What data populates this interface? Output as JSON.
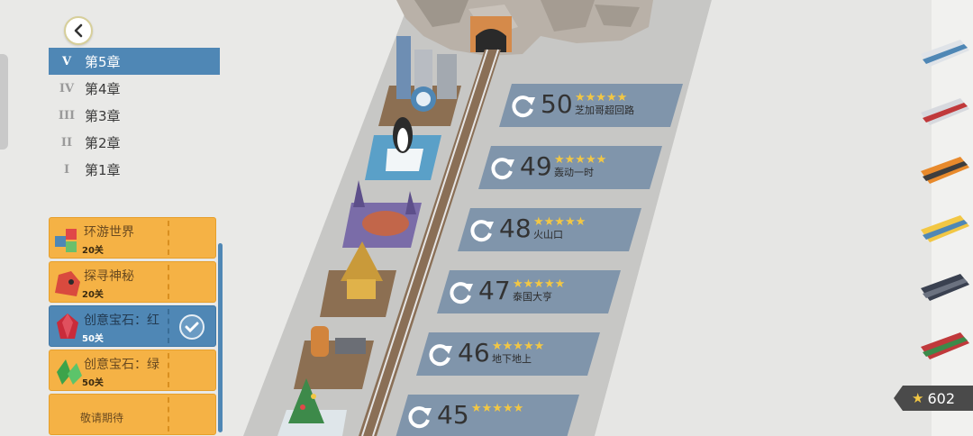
{
  "chapters": [
    {
      "numeral": "V",
      "label": "第5章",
      "active": true
    },
    {
      "numeral": "IV",
      "label": "第4章",
      "active": false
    },
    {
      "numeral": "III",
      "label": "第3章",
      "active": false
    },
    {
      "numeral": "II",
      "label": "第2章",
      "active": false
    },
    {
      "numeral": "I",
      "label": "第1章",
      "active": false
    }
  ],
  "packs": [
    {
      "title": "环游世界",
      "count": "20关",
      "thumb": "cubes-icon",
      "selected": false
    },
    {
      "title": "探寻神秘",
      "count": "20关",
      "thumb": "red-head-icon",
      "selected": false
    },
    {
      "title": "创意宝石：红",
      "count": "50关",
      "thumb": "red-gem-icon",
      "selected": true
    },
    {
      "title": "创意宝石：绿",
      "count": "50关",
      "thumb": "green-gem-icon",
      "selected": false
    },
    {
      "title": "敬请期待",
      "count": "",
      "thumb": "",
      "selected": false
    }
  ],
  "levels": [
    {
      "number": "50",
      "name": "芝加哥超回路",
      "stars": "★★★★★"
    },
    {
      "number": "49",
      "name": "轰动一时",
      "stars": "★★★★★"
    },
    {
      "number": "48",
      "name": "火山口",
      "stars": "★★★★★"
    },
    {
      "number": "47",
      "name": "泰国大亨",
      "stars": "★★★★★"
    },
    {
      "number": "46",
      "name": "地下地上",
      "stars": "★★★★★"
    },
    {
      "number": "45",
      "name": "",
      "stars": "★★★★★"
    }
  ],
  "trains": [
    "bullet-train-icon",
    "red-diesel-train-icon",
    "orange-locomotive-icon",
    "yellow-railcar-icon",
    "steam-engine-icon",
    "red-steam-engine-icon"
  ],
  "total_stars": "602",
  "colors": {
    "accent_blue": "#4f87b5",
    "level_bar": "#8095ab",
    "pack_orange": "#f5b245",
    "star_gold": "#f2c744",
    "track_band": "#c7c7c5"
  }
}
